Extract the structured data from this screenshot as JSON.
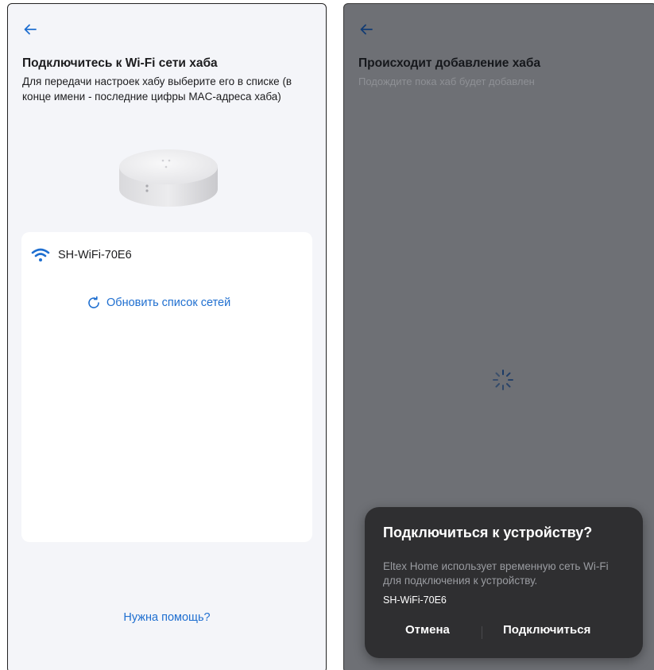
{
  "left_screen": {
    "title": "Подключитесь к Wi-Fi сети хаба",
    "description": "Для передачи настроек хабу выберите его в списке (в конце имени - последние цифры MAC-адреса хаба)",
    "networks": [
      {
        "ssid": "SH-WiFi-70E6"
      }
    ],
    "refresh_label": "Обновить список сетей",
    "help_label": "Нужна помощь?"
  },
  "right_screen": {
    "title": "Происходит добавление хаба",
    "subtitle": "Подождите пока хаб будет добавлен",
    "dialog": {
      "title": "Подключиться к устройству?",
      "body": "Eltex Home использует временную сеть Wi-Fi для подключения к устройству.",
      "network": "SH-WiFi-70E6",
      "cancel_label": "Отмена",
      "connect_label": "Подключиться"
    }
  },
  "colors": {
    "accent": "#1f6fd0",
    "left_background": "#f4f5f9",
    "right_overlay": "#6e7075",
    "dialog_background": "#2f2f31"
  },
  "icons": {
    "back": "arrow-left-icon",
    "wifi": "wifi-icon",
    "refresh": "refresh-icon",
    "spinner": "loading-spinner-icon"
  }
}
